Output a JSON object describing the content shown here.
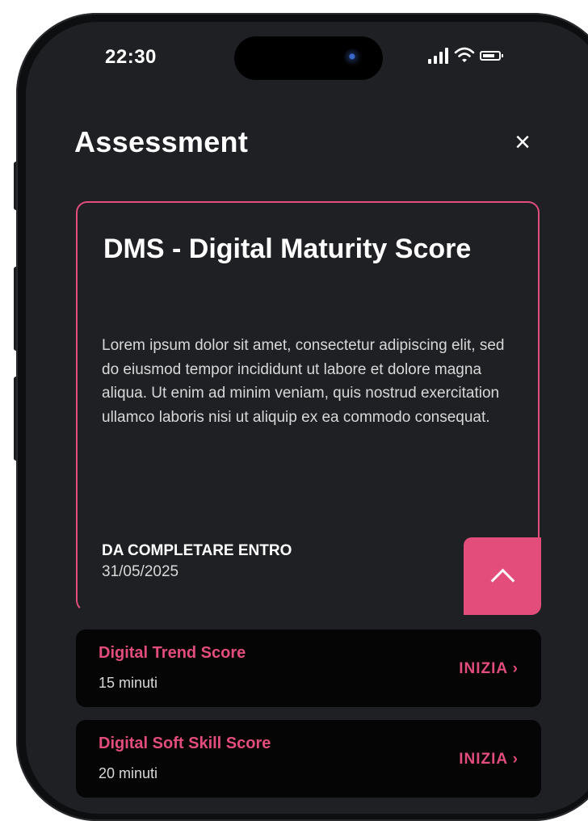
{
  "status_bar": {
    "time": "22:30"
  },
  "header": {
    "title": "Assessment",
    "close_symbol": "×"
  },
  "assessment_card": {
    "title": "DMS - Digital Maturity Score",
    "description": "Lorem ipsum dolor sit amet, consectetur adipiscing elit, sed do eiusmod tempor incididunt ut labore et dolore magna aliqua. Ut enim ad minim veniam, quis nostrud exercitation ullamco laboris nisi ut aliquip ex ea commodo consequat.",
    "due_label": "DA COMPLETARE ENTRO",
    "due_date": "31/05/2025",
    "expanded": true
  },
  "items": [
    {
      "title": "Digital Trend Score",
      "duration": "15 minuti",
      "cta": "INIZIA  ›"
    },
    {
      "title": "Digital Soft Skill Score",
      "duration": "20 minuti",
      "cta": "INIZIA  ›"
    }
  ],
  "colors": {
    "accent": "#e24d7c",
    "background": "#1f2023",
    "card_item": "#050505",
    "text": "#ffffff"
  },
  "icons": [
    "signal-icon",
    "wifi-icon",
    "battery-icon",
    "close-icon",
    "chevron-up-icon",
    "chevron-right-icon"
  ]
}
